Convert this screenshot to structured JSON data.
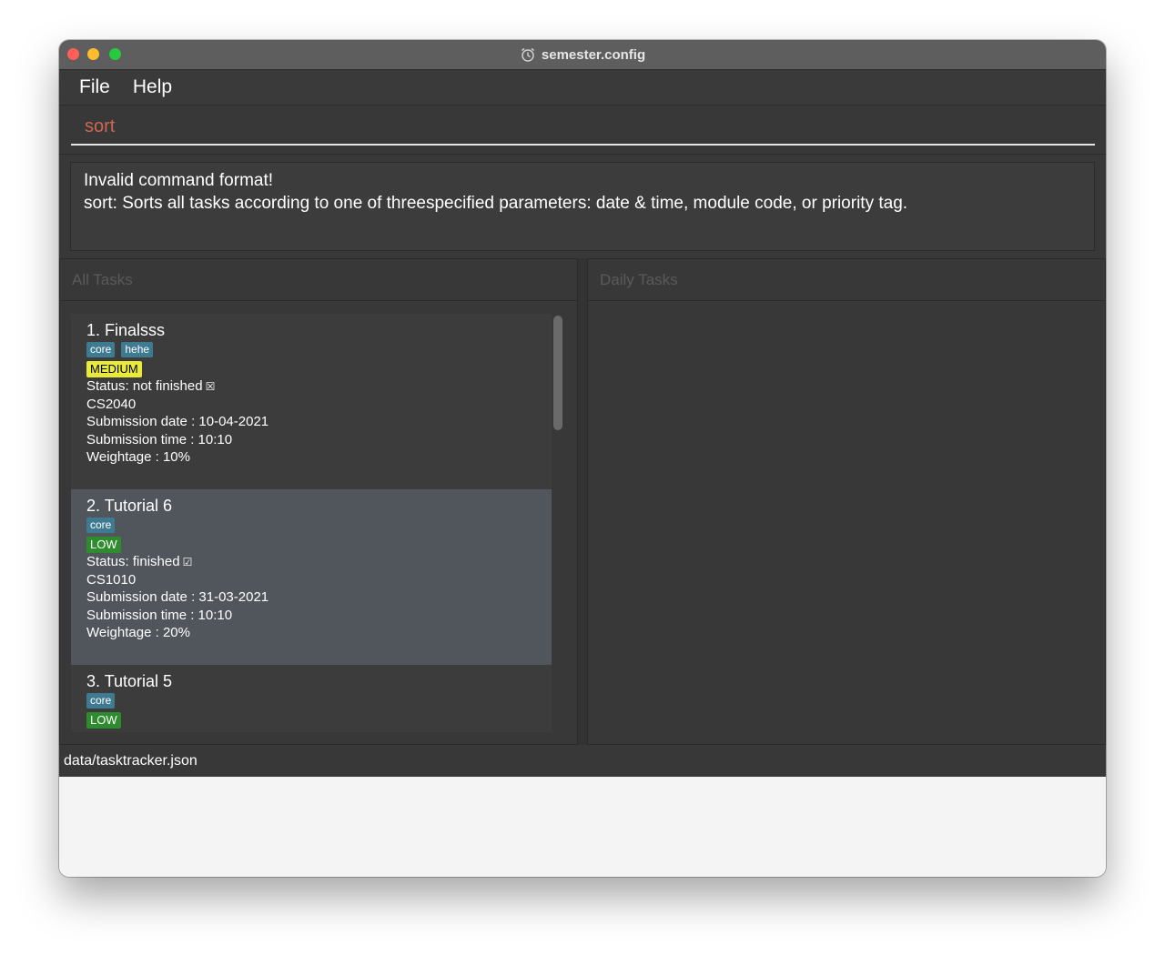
{
  "window": {
    "title": "semester.config"
  },
  "menu": {
    "items": [
      "File",
      "Help"
    ]
  },
  "command": {
    "value": "sort"
  },
  "result": {
    "line1": "Invalid command format!",
    "line2": "sort: Sorts all tasks according to one of threespecified parameters: date & time, module code, or priority tag."
  },
  "panels": {
    "all_tasks_title": "All Tasks",
    "daily_tasks_title": "Daily Tasks"
  },
  "tasks": [
    {
      "title": "1.  Finalsss",
      "tags": [
        "core",
        "hehe"
      ],
      "priority": "MEDIUM",
      "status": "Status: not finished",
      "status_icon": "☒",
      "module": "CS2040",
      "date": "Submission date : 10-04-2021",
      "time": "Submission time : 10:10",
      "weightage": "Weightage : 10%"
    },
    {
      "title": "2.  Tutorial 6",
      "tags": [
        "core"
      ],
      "priority": "LOW",
      "status": "Status: finished",
      "status_icon": "☑",
      "module": "CS1010",
      "date": "Submission date : 31-03-2021",
      "time": "Submission time : 10:10",
      "weightage": "Weightage : 20%"
    },
    {
      "title": "3.  Tutorial 5",
      "tags": [
        "core"
      ],
      "priority": "LOW"
    }
  ],
  "statusbar": {
    "path": "data/tasktracker.json"
  },
  "colors": {
    "priority_medium": "#eaea3a",
    "priority_low": "#2e8b2e",
    "tag": "#3e7b91",
    "command_text": "#d06651"
  }
}
